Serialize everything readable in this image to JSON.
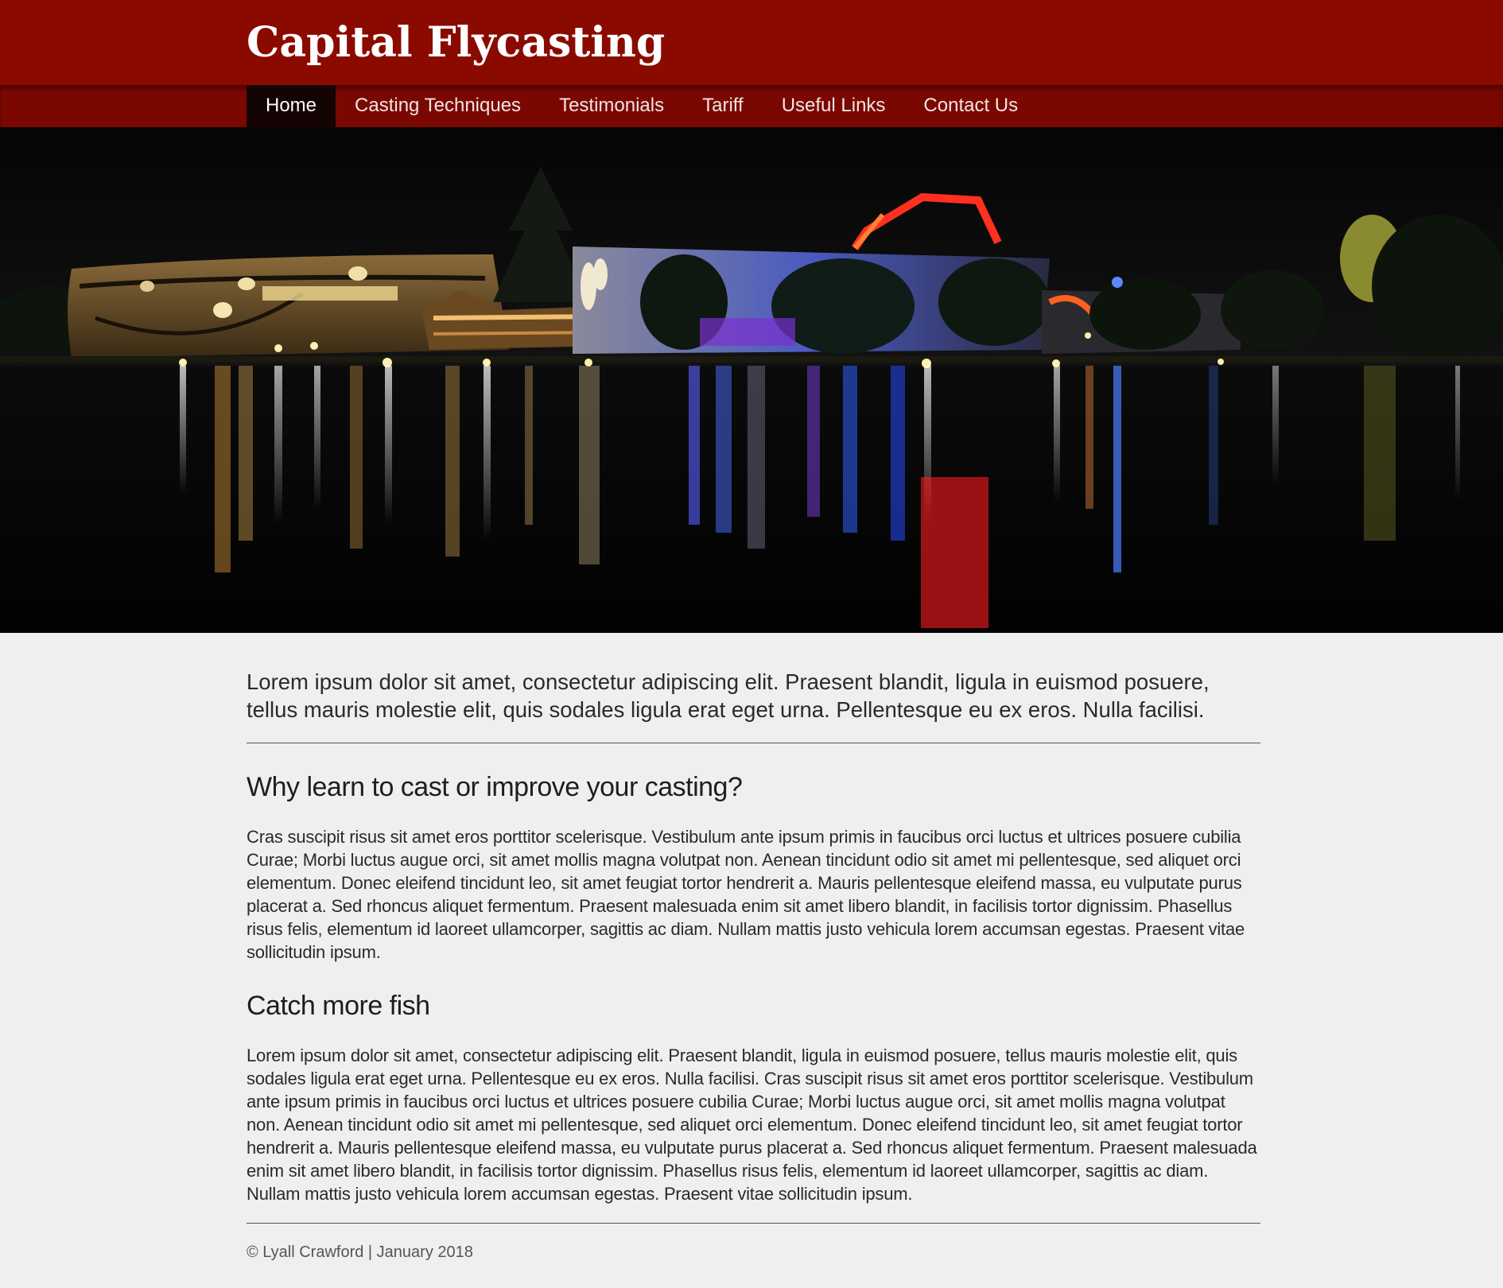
{
  "header": {
    "site_title": "Capital Flycasting"
  },
  "nav": {
    "items": [
      {
        "label": "Home",
        "active": true
      },
      {
        "label": "Casting Techniques",
        "active": false
      },
      {
        "label": "Testimonials",
        "active": false
      },
      {
        "label": "Tariff",
        "active": false
      },
      {
        "label": "Useful Links",
        "active": false
      },
      {
        "label": "Contact Us",
        "active": false
      }
    ]
  },
  "hero": {
    "image": "night-lake-building-reflections"
  },
  "main": {
    "lead": "Lorem ipsum dolor sit amet, consectetur adipiscing elit. Praesent blandit, ligula in euismod posuere, tellus mauris molestie elit, quis sodales ligula erat eget urna. Pellentesque eu ex eros. Nulla facilisi.",
    "sections": [
      {
        "heading": "Why learn to cast or improve your casting?",
        "body": "Cras suscipit risus sit amet eros porttitor scelerisque. Vestibulum ante ipsum primis in faucibus orci luctus et ultrices posuere cubilia Curae; Morbi luctus augue orci, sit amet mollis magna volutpat non. Aenean tincidunt odio sit amet mi pellentesque, sed aliquet orci elementum. Donec eleifend tincidunt leo, sit amet feugiat tortor hendrerit a. Mauris pellentesque eleifend massa, eu vulputate purus placerat a. Sed rhoncus aliquet fermentum. Praesent malesuada enim sit amet libero blandit, in facilisis tortor dignissim. Phasellus risus felis, elementum id laoreet ullamcorper, sagittis ac diam. Nullam mattis justo vehicula lorem accumsan egestas. Praesent vitae sollicitudin ipsum."
      },
      {
        "heading": "Catch more fish",
        "body": "Lorem ipsum dolor sit amet, consectetur adipiscing elit. Praesent blandit, ligula in euismod posuere, tellus mauris molestie elit, quis sodales ligula erat eget urna. Pellentesque eu ex eros. Nulla facilisi. Cras suscipit risus sit amet eros porttitor scelerisque. Vestibulum ante ipsum primis in faucibus orci luctus et ultrices posuere cubilia Curae; Morbi luctus augue orci, sit amet mollis magna volutpat non. Aenean tincidunt odio sit amet mi pellentesque, sed aliquet orci elementum. Donec eleifend tincidunt leo, sit amet feugiat tortor hendrerit a. Mauris pellentesque eleifend massa, eu vulputate purus placerat a. Sed rhoncus aliquet fermentum. Praesent malesuada enim sit amet libero blandit, in facilisis tortor dignissim. Phasellus risus felis, elementum id laoreet ullamcorper, sagittis ac diam. Nullam mattis justo vehicula lorem accumsan egestas. Praesent vitae sollicitudin ipsum."
      }
    ]
  },
  "footer": {
    "text": "© Lyall Crawford | January 2018"
  },
  "colors": {
    "header_bg": "#8b0a00",
    "nav_bg": "#7a0800",
    "nav_active_bg": "#150404",
    "page_bg": "#efefef",
    "text": "#2a2a2a"
  }
}
